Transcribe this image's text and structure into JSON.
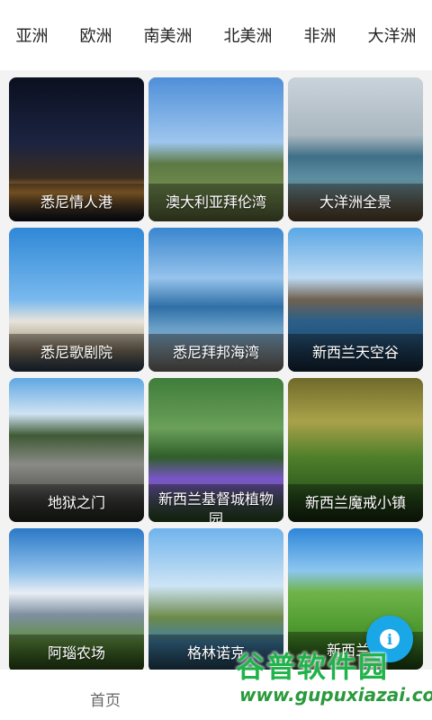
{
  "tabs": [
    "亚洲",
    "欧洲",
    "南美洲",
    "北美洲",
    "非洲",
    "大洋洲"
  ],
  "cards": [
    {
      "label": "悉尼情人港"
    },
    {
      "label": "澳大利亚拜伦湾"
    },
    {
      "label": "大洋洲全景"
    },
    {
      "label": "悉尼歌剧院"
    },
    {
      "label": "悉尼拜邦海湾"
    },
    {
      "label": "新西兰天空谷"
    },
    {
      "label": "地狱之门"
    },
    {
      "label": "新西兰基督城植物园"
    },
    {
      "label": "新西兰魔戒小镇"
    },
    {
      "label": "阿瑙农场"
    },
    {
      "label": "格林诺克"
    },
    {
      "label": "新西兰秋"
    }
  ],
  "fab": {
    "icon": "info-icon",
    "glyph": "i",
    "color": "#19a7e8"
  },
  "bottom_nav": {
    "home_label": "首页"
  },
  "watermark": {
    "title": "谷普软件园",
    "url": "www.gupuxiazai.com",
    "color": "#20b34a"
  }
}
